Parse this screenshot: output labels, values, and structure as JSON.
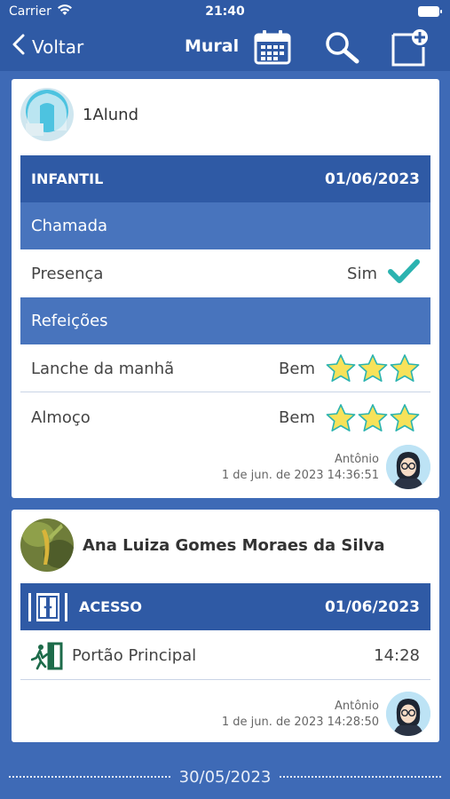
{
  "status_bar": {
    "carrier": "Carrier",
    "time": "21:40"
  },
  "nav": {
    "back_label": "Voltar",
    "title": "Mural"
  },
  "cards": [
    {
      "name": "1Alund",
      "header": {
        "label": "INFANTIL",
        "date": "01/06/2023"
      },
      "sections": [
        {
          "title": "Chamada",
          "rows": [
            {
              "label": "Presença",
              "value": "Sim"
            }
          ]
        },
        {
          "title": "Refeições",
          "rows": [
            {
              "label": "Lanche da manhã",
              "value": "Bem",
              "rating": 3
            },
            {
              "label": "Almoço",
              "value": "Bem",
              "rating": 3
            }
          ]
        }
      ],
      "author": "Antônio",
      "timestamp": "1 de jun. de 2023 14:36:51"
    },
    {
      "name": "Ana Luiza Gomes Moraes da Silva",
      "header": {
        "label": "ACESSO",
        "date": "01/06/2023"
      },
      "rows": [
        {
          "label": "Portão Principal",
          "value": "14:28",
          "icon": "exit-door-icon"
        }
      ],
      "author": "Antônio",
      "timestamp": "1 de jun. de 2023 14:28:50"
    }
  ],
  "date_divider": "30/05/2023",
  "colors": {
    "primary": "#2f5aa5",
    "subheader": "#4874bd",
    "check": "#2bb3b0",
    "star": "#f7e25a"
  }
}
